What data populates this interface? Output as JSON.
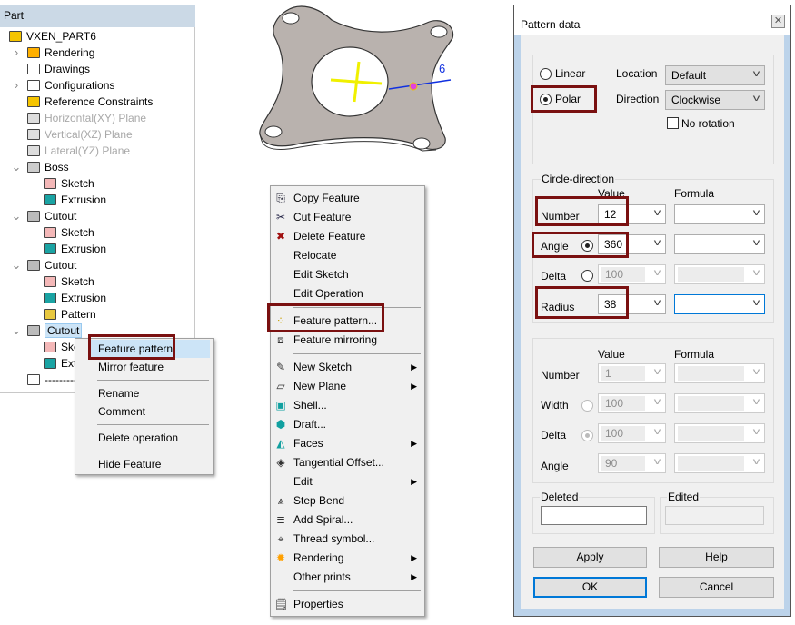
{
  "tree": {
    "header": "Part",
    "items": [
      {
        "label": "VXEN_PART6",
        "level": 0,
        "icon": "part-icon",
        "color": "#f5c400"
      },
      {
        "label": "Rendering",
        "level": 1,
        "icon": "sun-icon",
        "color": "#ffb000",
        "exp": ">"
      },
      {
        "label": "Drawings",
        "level": 1,
        "icon": "drawings-icon",
        "color": "#fff"
      },
      {
        "label": "Configurations",
        "level": 1,
        "icon": "configurations-icon",
        "color": "#fff",
        "exp": ">"
      },
      {
        "label": "Reference Constraints",
        "level": 1,
        "icon": "magnet-icon",
        "color": "#f5c400"
      },
      {
        "label": "Horizontal(XY) Plane",
        "level": 1,
        "icon": "plane-icon",
        "color": "#ddd",
        "dis": true
      },
      {
        "label": "Vertical(XZ) Plane",
        "level": 1,
        "icon": "plane-icon",
        "color": "#ddd",
        "dis": true
      },
      {
        "label": "Lateral(YZ) Plane",
        "level": 1,
        "icon": "plane-icon",
        "color": "#ddd",
        "dis": true
      },
      {
        "label": "Boss",
        "level": 1,
        "icon": "boss-icon",
        "color": "#ccc",
        "exp": "v"
      },
      {
        "label": "Sketch",
        "level": 2,
        "icon": "sketch-icon",
        "color": "#f4b8b8"
      },
      {
        "label": "Extrusion",
        "level": 2,
        "icon": "extrusion-icon",
        "color": "#1aa3a3"
      },
      {
        "label": "Cutout",
        "level": 1,
        "icon": "cutout-icon",
        "color": "#bbb",
        "exp": "v"
      },
      {
        "label": "Sketch",
        "level": 2,
        "icon": "sketch-icon",
        "color": "#f4b8b8"
      },
      {
        "label": "Extrusion",
        "level": 2,
        "icon": "extrusion-icon",
        "color": "#1aa3a3"
      },
      {
        "label": "Cutout",
        "level": 1,
        "icon": "cutout-icon",
        "color": "#bbb",
        "exp": "v"
      },
      {
        "label": "Sketch",
        "level": 2,
        "icon": "sketch-icon",
        "color": "#f4b8b8"
      },
      {
        "label": "Extrusion",
        "level": 2,
        "icon": "extrusion-icon",
        "color": "#1aa3a3"
      },
      {
        "label": "Pattern",
        "level": 2,
        "icon": "pattern-icon",
        "color": "#e8c840"
      },
      {
        "label": "Cutout",
        "level": 1,
        "icon": "cutout-icon",
        "color": "#bbb",
        "exp": "v",
        "sel": true
      },
      {
        "label": "Sketch",
        "level": 2,
        "icon": "sketch-icon",
        "color": "#f4b8b8"
      },
      {
        "label": "Extrusion",
        "level": 2,
        "icon": "extrusion-icon",
        "color": "#1aa3a3"
      },
      {
        "label": "-----------",
        "level": 1,
        "icon": "rollback-icon",
        "color": "#fff"
      }
    ]
  },
  "tree_menu": {
    "items": [
      {
        "label": "Feature pattern",
        "hl": true
      },
      {
        "label": "Mirror feature"
      },
      {
        "sep": true
      },
      {
        "label": "Rename"
      },
      {
        "label": "Comment"
      },
      {
        "sep": true
      },
      {
        "label": "Delete operation"
      },
      {
        "sep": true
      },
      {
        "label": "Hide Feature"
      }
    ]
  },
  "viewport": {
    "dimension_label": "6"
  },
  "feature_menu": {
    "items": [
      {
        "label": "Copy Feature",
        "icon": "copy-icon",
        "glyph": "⎘",
        "color": "#223"
      },
      {
        "label": "Cut Feature",
        "icon": "scissors-icon",
        "glyph": "✂",
        "color": "#224"
      },
      {
        "label": "Delete Feature",
        "icon": "delete-x-icon",
        "glyph": "✖",
        "color": "#a01010"
      },
      {
        "label": "Relocate"
      },
      {
        "label": "Edit Sketch"
      },
      {
        "label": "Edit Operation"
      },
      {
        "sep": true
      },
      {
        "label": "Feature pattern...",
        "icon": "pattern-icon",
        "glyph": "⁘",
        "color": "#c9a000"
      },
      {
        "label": "Feature mirroring",
        "icon": "mirror-icon",
        "glyph": "⧈",
        "color": "#333"
      },
      {
        "sep": true
      },
      {
        "label": "New Sketch",
        "icon": "pencil-icon",
        "glyph": "✎",
        "color": "#333",
        "sub": true
      },
      {
        "label": "New Plane",
        "icon": "plane-icon",
        "glyph": "▱",
        "color": "#333",
        "sub": true
      },
      {
        "label": "Shell...",
        "icon": "shell-icon",
        "glyph": "▣",
        "color": "#11a0a0"
      },
      {
        "label": "Draft...",
        "icon": "draft-icon",
        "glyph": "⬢",
        "color": "#11a0a0"
      },
      {
        "label": "Faces",
        "icon": "faces-icon",
        "glyph": "◭",
        "color": "#11a0a0",
        "sub": true
      },
      {
        "label": "Tangential Offset...",
        "icon": "offset-icon",
        "glyph": "◈",
        "color": "#333"
      },
      {
        "label": "Edit",
        "sub": true
      },
      {
        "label": "Step Bend",
        "icon": "step-bend-icon",
        "glyph": "⩓",
        "color": "#333"
      },
      {
        "label": "Add Spiral...",
        "icon": "spiral-icon",
        "glyph": "≣",
        "color": "#333"
      },
      {
        "label": "Thread symbol...",
        "icon": "thread-icon",
        "glyph": "⌖",
        "color": "#333"
      },
      {
        "label": "Rendering",
        "icon": "sun-icon",
        "glyph": "✹",
        "color": "#ffa000",
        "sub": true
      },
      {
        "label": "Other prints",
        "sub": true
      },
      {
        "sep": true
      },
      {
        "label": "Properties",
        "icon": "properties-icon",
        "glyph": "🗒",
        "color": "#333"
      }
    ]
  },
  "dialog": {
    "title": "Pattern data",
    "type": {
      "linear": "Linear",
      "polar": "Polar",
      "selected": "Polar"
    },
    "location": {
      "label": "Location",
      "value": "Default"
    },
    "direction": {
      "label": "Direction",
      "value": "Clockwise"
    },
    "no_rotation": {
      "label": "No rotation",
      "checked": false
    },
    "circle": {
      "title": "Circle-direction",
      "value_header": "Value",
      "formula_header": "Formula",
      "number": {
        "label": "Number",
        "value": "12",
        "formula": ""
      },
      "angle": {
        "label": "Angle",
        "value": "360",
        "formula": ""
      },
      "delta": {
        "label": "Delta",
        "value": "100",
        "formula": ""
      },
      "radius": {
        "label": "Radius",
        "value": "38",
        "formula": ""
      }
    },
    "linear": {
      "value_header": "Value",
      "formula_header": "Formula",
      "number": {
        "label": "Number",
        "value": "1"
      },
      "width": {
        "label": "Width",
        "value": "100"
      },
      "delta": {
        "label": "Delta",
        "value": "100"
      },
      "angle": {
        "label": "Angle",
        "value": "90"
      }
    },
    "deleted": {
      "label": "Deleted",
      "value": ""
    },
    "edited": {
      "label": "Edited",
      "value": ""
    },
    "buttons": {
      "apply": "Apply",
      "help": "Help",
      "ok": "OK",
      "cancel": "Cancel"
    }
  }
}
